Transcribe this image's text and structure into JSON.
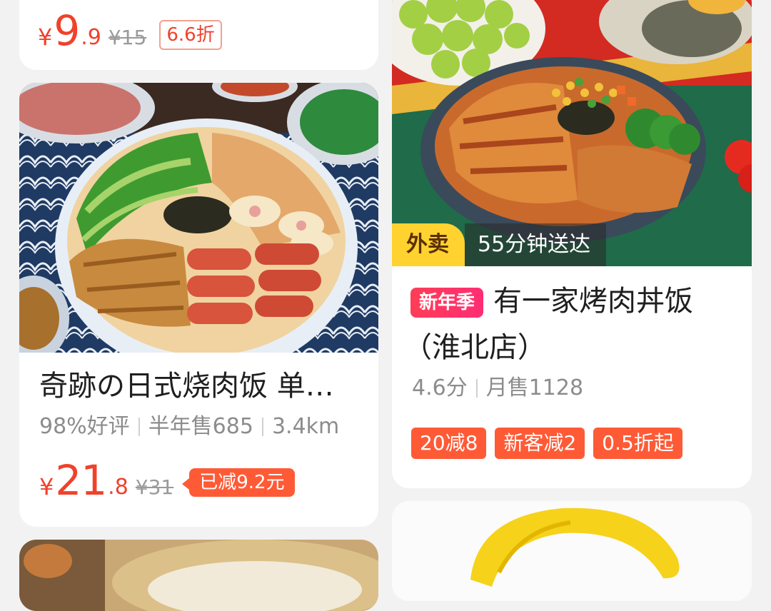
{
  "colors": {
    "accent": "#f0412b",
    "tag_bg": "#ff5a36",
    "delivery_badge": "#ffd230"
  },
  "cards": [
    {
      "price": {
        "currency": "¥",
        "integer": "9",
        "decimal": ".9",
        "original": "¥15",
        "discount": "6.6折"
      }
    },
    {
      "title": "奇跡の日式烧肉饭 单…",
      "rating": "98%好评",
      "sales": "半年售685",
      "distance": "3.4km",
      "price": {
        "currency": "¥",
        "integer": "21",
        "decimal": ".8",
        "original": "¥31",
        "discount": "已减9.2元"
      }
    },
    {
      "delivery_type": "外卖",
      "delivery_time": "55分钟送达",
      "badge": "新年季",
      "title_line1": "有一家烤肉丼饭",
      "title_line2": "（淮北店）",
      "score": "4.6分",
      "monthly_sales": "月售1128",
      "tags": [
        "20减8",
        "新客减2",
        "0.5折起"
      ]
    }
  ]
}
